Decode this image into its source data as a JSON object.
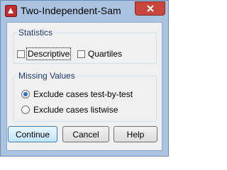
{
  "window": {
    "title": "Two-Independent-Sam",
    "close_icon": "close-icon"
  },
  "statistics": {
    "legend": "Statistics",
    "descriptive_label": "Descriptive",
    "quartiles_label": "Quartiles"
  },
  "missing_values": {
    "legend": "Missing Values",
    "options": [
      {
        "label": "Exclude cases test-by-test",
        "selected": true
      },
      {
        "label": "Exclude cases listwise",
        "selected": false
      }
    ]
  },
  "buttons": {
    "continue": "Continue",
    "cancel": "Cancel",
    "help": "Help"
  },
  "colors": {
    "title_bar": "#a9c3e0",
    "close_button": "#c9463d",
    "group_legend": "#1f3b6d",
    "radio_selected": "#2a6fd1"
  }
}
